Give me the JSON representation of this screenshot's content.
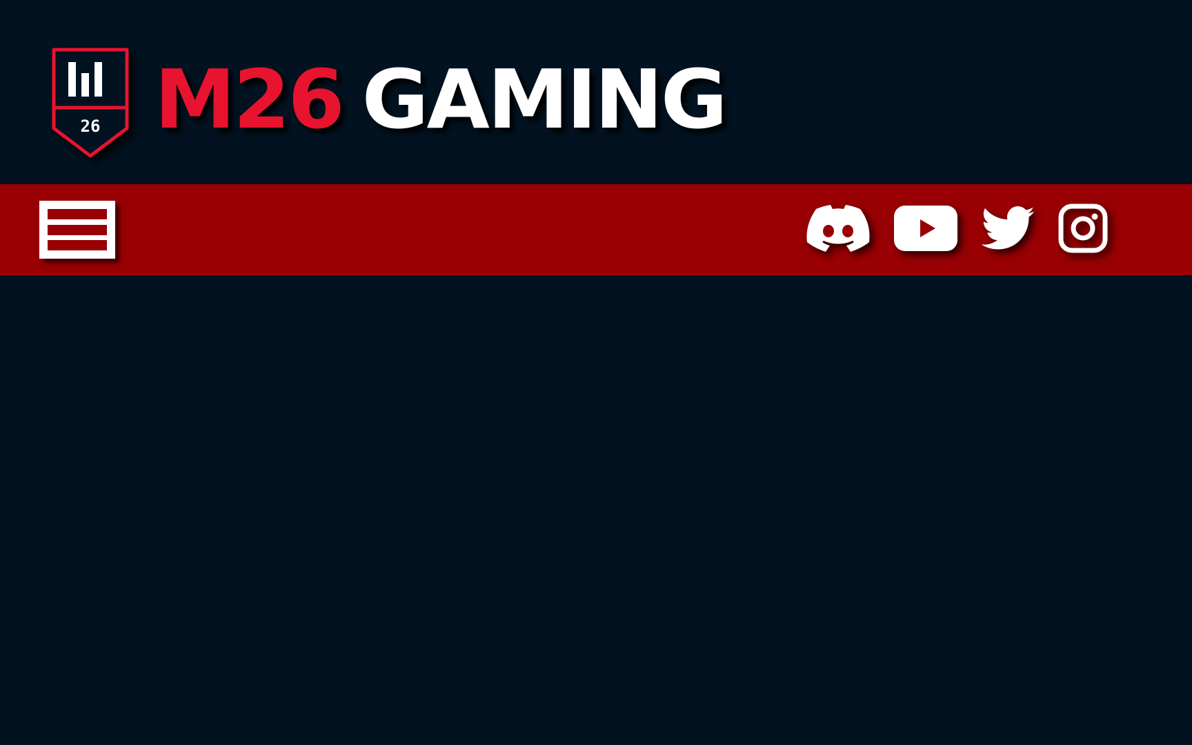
{
  "brand": {
    "badge_number": "26",
    "name_accent": "M26",
    "name_rest": "GAMING"
  },
  "navbar": {
    "menu_icon": "hamburger-menu-icon",
    "socials": [
      {
        "name": "discord-icon"
      },
      {
        "name": "youtube-icon"
      },
      {
        "name": "twitter-icon"
      },
      {
        "name": "instagram-icon"
      }
    ]
  },
  "colors": {
    "background": "#021220",
    "navbar": "#980003",
    "accent_red": "#e8132f",
    "white": "#ffffff"
  }
}
